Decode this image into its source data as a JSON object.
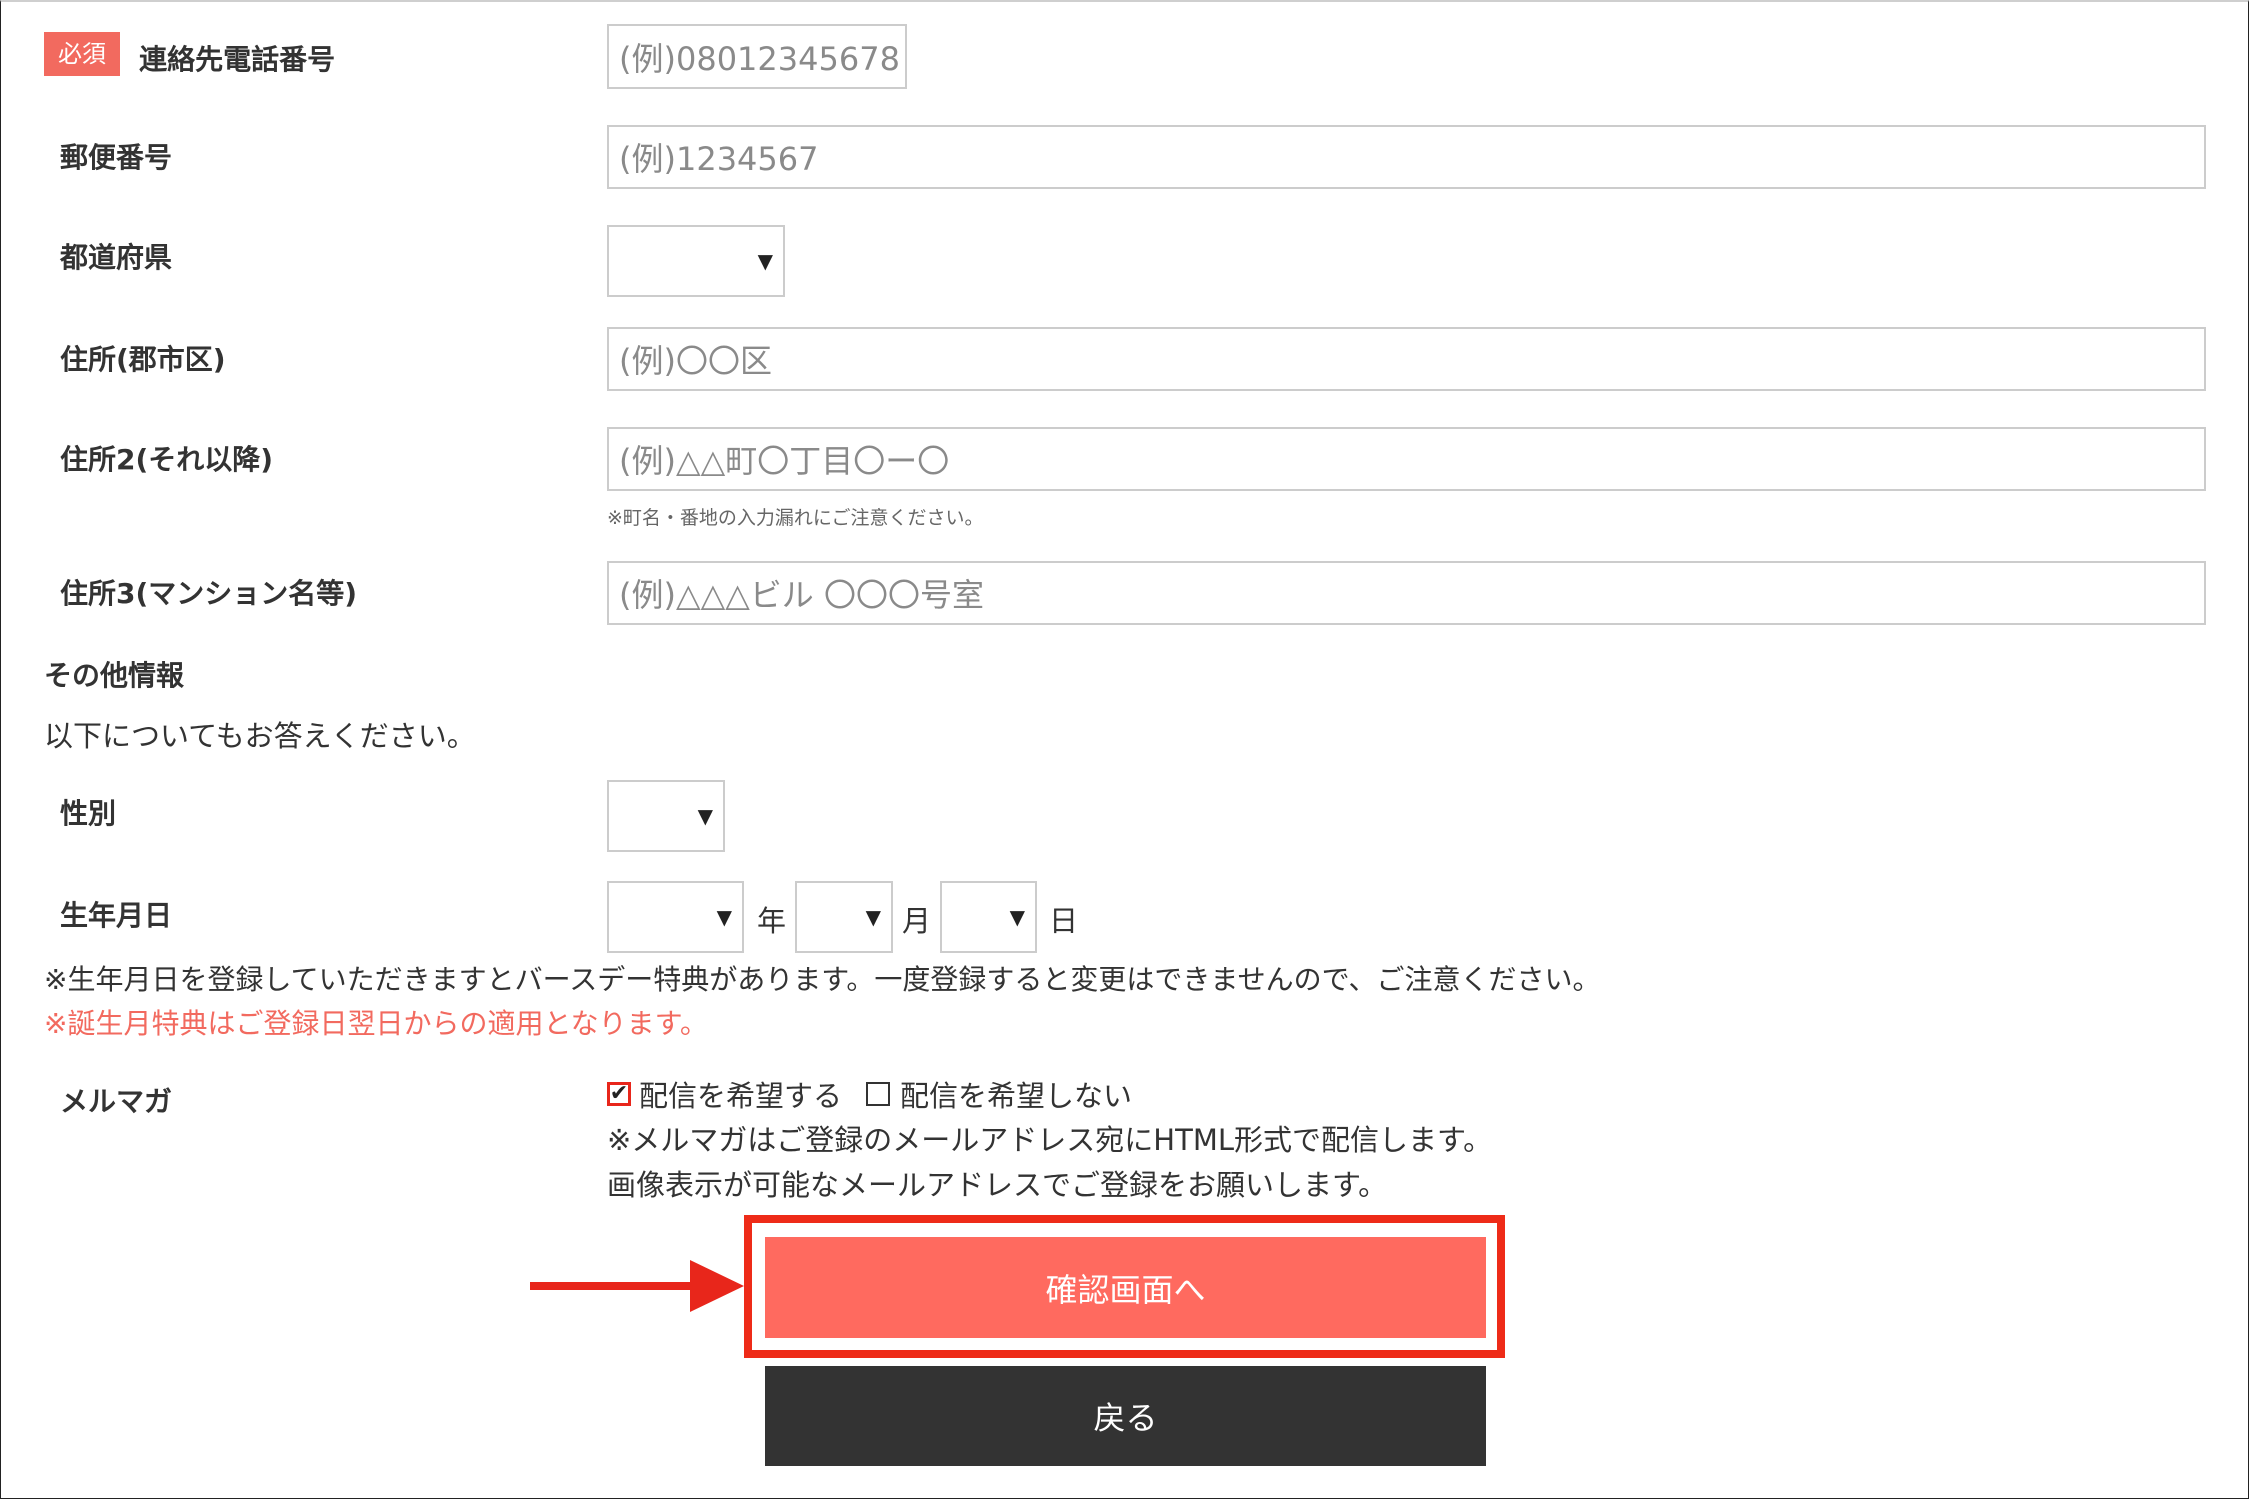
{
  "form": {
    "required_badge": "必須",
    "phone": {
      "label": "連絡先電話番号",
      "placeholder": "(例)08012345678"
    },
    "postal": {
      "label": "郵便番号",
      "placeholder": "(例)1234567"
    },
    "prefecture": {
      "label": "都道府県"
    },
    "address1": {
      "label": "住所(郡市区)",
      "placeholder": "(例)〇〇区"
    },
    "address2": {
      "label": "住所2(それ以降)",
      "placeholder": "(例)△△町〇丁目〇ー〇",
      "note": "※町名・番地の入力漏れにご注意ください。"
    },
    "address3": {
      "label": "住所3(マンション名等)",
      "placeholder": "(例)△△△ビル 〇〇〇号室"
    }
  },
  "other": {
    "heading": "その他情報",
    "description": "以下についてもお答えください。",
    "gender": {
      "label": "性別"
    },
    "birthday": {
      "label": "生年月日",
      "year_unit": "年",
      "month_unit": "月",
      "day_unit": "日",
      "note": "※生年月日を登録していただきますとバースデー特典があります。一度登録すると変更はできませんので、ご注意ください。",
      "note_red": "※誕生月特典はご登録日翌日からの適用となります。"
    },
    "newsletter": {
      "label": "メルマガ",
      "option_yes": "配信を希望する",
      "option_no": "配信を希望しない",
      "option_yes_checked": true,
      "note1": "※メルマガはご登録のメールアドレス宛にHTML形式で配信します。",
      "note2": "画像表示が可能なメールアドレスでご登録をお願いします。"
    }
  },
  "buttons": {
    "confirm": "確認画面へ",
    "back": "戻る"
  },
  "colors": {
    "accent": "#ff6a5f",
    "highlight": "#ee2b18",
    "badge": "#f26a5f",
    "back_button": "#333333"
  }
}
